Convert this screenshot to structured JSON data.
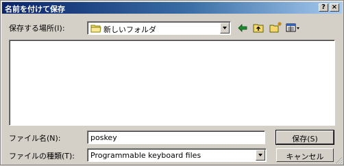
{
  "window": {
    "title": "名前を付けて保存",
    "help_button": "?",
    "close_button": "×"
  },
  "location": {
    "label": "保存する場所(I):",
    "current_folder": "新しいフォルダ"
  },
  "toolbar": {
    "icons": [
      "back-arrow-icon",
      "up-folder-icon",
      "new-folder-icon",
      "view-menu-icon"
    ]
  },
  "filename": {
    "label": "ファイル名(N):",
    "value": "poskey"
  },
  "filetype": {
    "label": "ファイルの種類(T):",
    "value": "Programmable keyboard files"
  },
  "buttons": {
    "save": "保存(S)",
    "cancel": "キャンセル"
  },
  "colors": {
    "title_start": "#0a246a",
    "title_end": "#a6caf0",
    "face": "#d4d0c8",
    "folder": "#f5d76e"
  }
}
